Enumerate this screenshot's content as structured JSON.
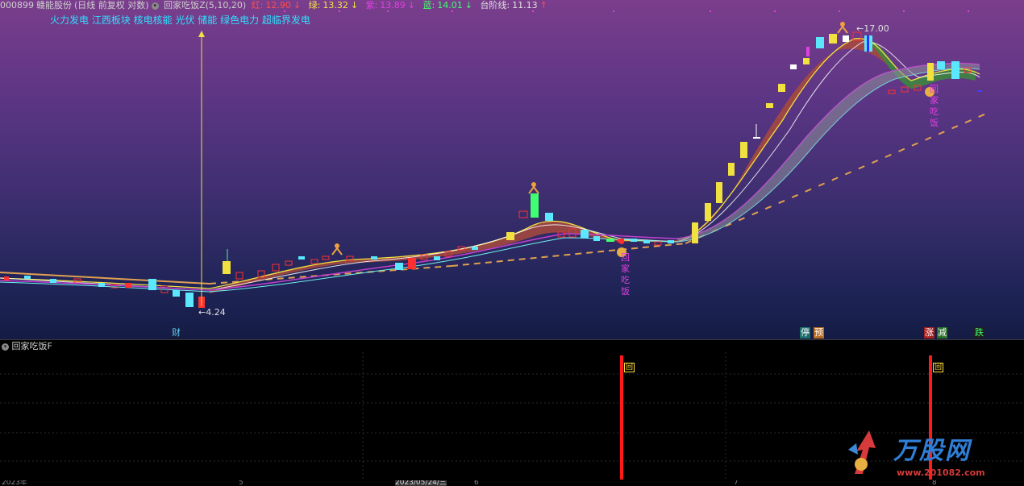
{
  "header": {
    "code": "000899",
    "name": "赣能股份",
    "mode": "(日线 前复权 对数)",
    "indicator": "回家吃饭Z(5,10,20)",
    "red": {
      "label": "红:",
      "value": "12.90",
      "arrow": "↓",
      "color": "#ff4d4d"
    },
    "green": {
      "label": "绿:",
      "value": "13.32",
      "arrow": "↓",
      "color": "#f2e640"
    },
    "purple": {
      "label": "紫:",
      "value": "13.89",
      "arrow": "↓",
      "color": "#e040e0"
    },
    "blue": {
      "label": "蓝:",
      "value": "14.01",
      "arrow": "↓",
      "color": "#40ff70"
    },
    "step": {
      "label": "台阶线:",
      "value": "11.13",
      "arrow": "↑",
      "color": "#e0e0e0"
    }
  },
  "sectors": "火力发电 江西板块 核电核能 光伏 储能 绿色电力 超临界发电",
  "annotations": {
    "low_price": "4.24",
    "high_price": "17.00",
    "signal_left": [
      "回",
      "家",
      "吃",
      "饭"
    ],
    "signal_right": [
      "回",
      "家",
      "吃",
      "饭"
    ]
  },
  "event_markers": [
    {
      "text": "财",
      "bg": "#1a1a1a",
      "color": "#5ad1ff"
    },
    {
      "text": "停",
      "bg": "#1e6e6e",
      "color": "#ffffff"
    },
    {
      "text": "预",
      "bg": "#b86a1e",
      "color": "#ffffff"
    },
    {
      "text": "涨",
      "bg": "#a82020",
      "color": "#ffffff"
    },
    {
      "text": "减",
      "bg": "#2a6e2a",
      "color": "#ffffff"
    },
    {
      "text": "跌",
      "bg": "#1e1e1e",
      "color": "#40ff70"
    }
  ],
  "sub_indicator": {
    "name": "回家吃饭F",
    "signal_label": "回"
  },
  "axis": {
    "year": "2023年",
    "month_5": "5",
    "cursor_date": "2023/05/24/三",
    "month_6": "6",
    "month_7": "7",
    "month_8": "8"
  },
  "watermark": {
    "title": "万股网",
    "url": "www.201082.com"
  },
  "chart_data": {
    "type": "candlestick",
    "price_scale": "log",
    "annotated_low": 4.24,
    "annotated_high": 17.0,
    "indicator_lines": {
      "red": 12.9,
      "green": 13.32,
      "purple": 13.89,
      "blue": 14.01,
      "step": 11.13
    }
  }
}
